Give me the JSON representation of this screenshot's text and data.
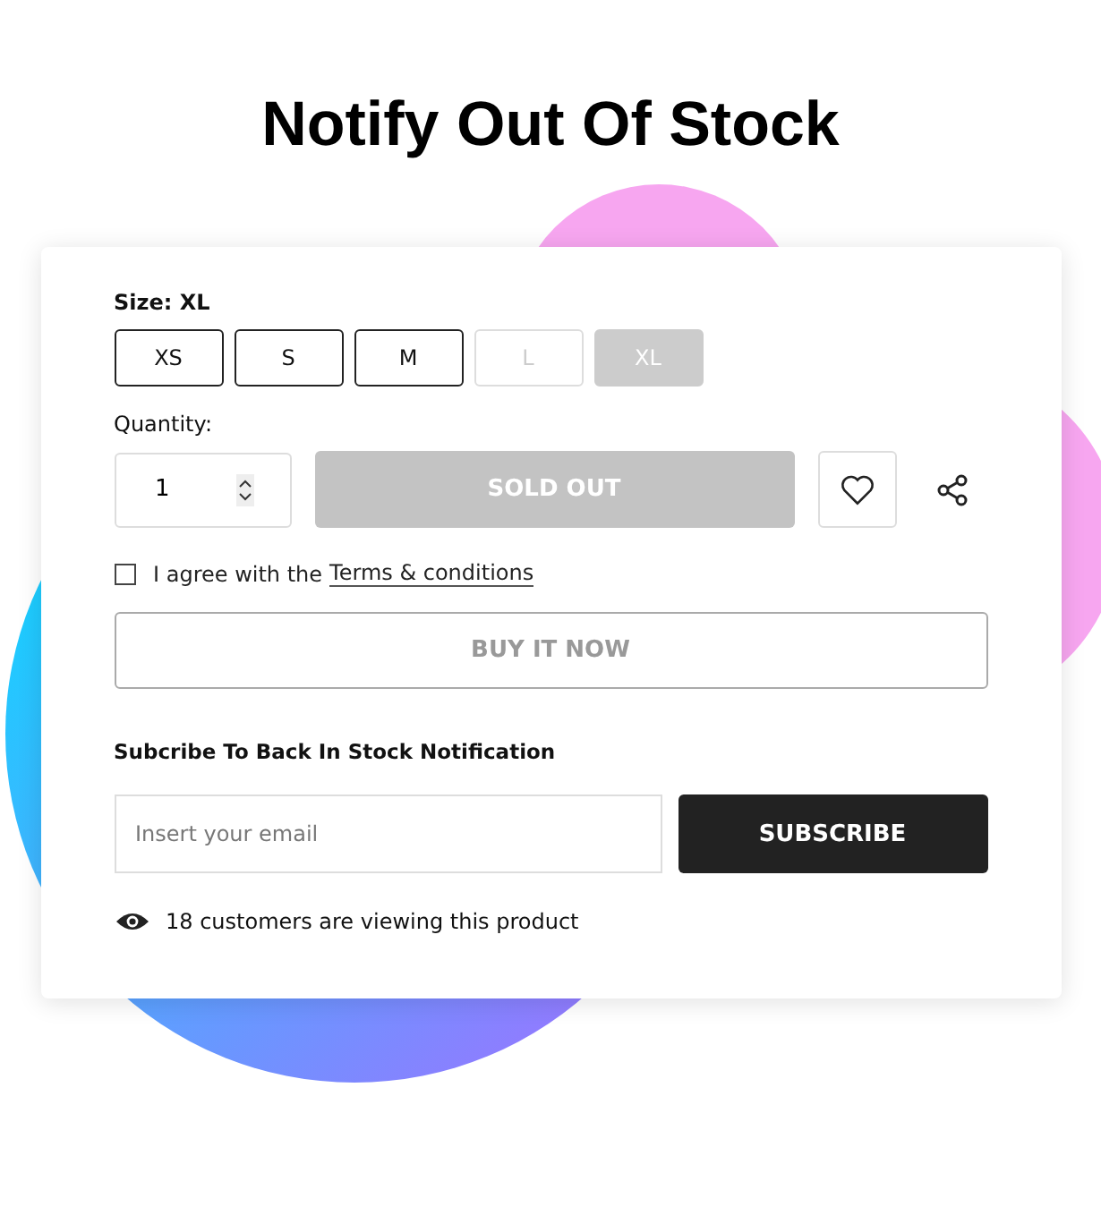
{
  "title": "Notify Out Of Stock",
  "size": {
    "label": "Size:",
    "value": "XL",
    "options": [
      {
        "label": "XS",
        "available": true,
        "selected": false
      },
      {
        "label": "S",
        "available": true,
        "selected": false
      },
      {
        "label": "M",
        "available": true,
        "selected": false
      },
      {
        "label": "L",
        "available": false,
        "selected": false
      },
      {
        "label": "XL",
        "available": false,
        "selected": true
      }
    ]
  },
  "quantity": {
    "label": "Quantity:",
    "value": "1"
  },
  "sold_out_button": {
    "label": "SOLD OUT",
    "disabled": true
  },
  "terms": {
    "checked": false,
    "text": "I agree with the",
    "link": "Terms & conditions"
  },
  "buy_now_button": {
    "label": "BUY IT NOW",
    "disabled": true
  },
  "subscribe": {
    "heading": "Subcribe To Back In Stock Notification",
    "placeholder": "Insert your email",
    "button": "SUBSCRIBE"
  },
  "viewers": "18 customers are viewing this product"
}
